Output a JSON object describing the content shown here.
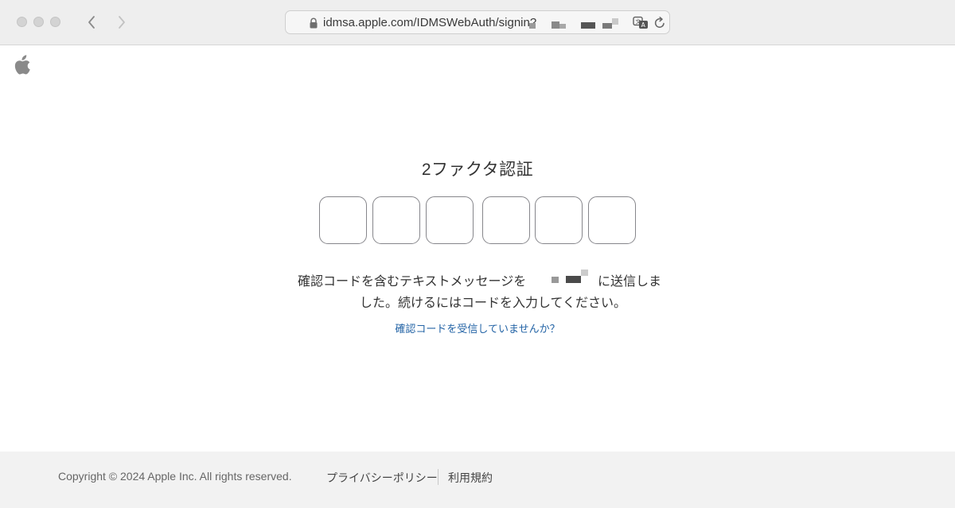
{
  "browser": {
    "url": "idmsa.apple.com/IDMSWebAuth/signin?",
    "back_icon": "chevron-left-icon",
    "forward_icon": "chevron-right-icon"
  },
  "main": {
    "title": "2ファクタ認証",
    "code_digits": [
      "",
      "",
      "",
      "",
      "",
      ""
    ],
    "message_line1_start": "確認コードを含むテキストメッセージを",
    "message_line1_end": "に送信しま",
    "message_line2": "した。続けるにはコードを入力してください。",
    "help_link": "確認コードを受信していませんか？"
  },
  "footer": {
    "copyright": "Copyright © 2024 Apple Inc. All rights reserved.",
    "privacy_link": "プライバシーポリシー",
    "terms_link": "利用規約"
  },
  "colors": {
    "link": "#2464a6",
    "chrome_bg": "#eeeeee",
    "footer_bg": "#f2f2f2"
  }
}
